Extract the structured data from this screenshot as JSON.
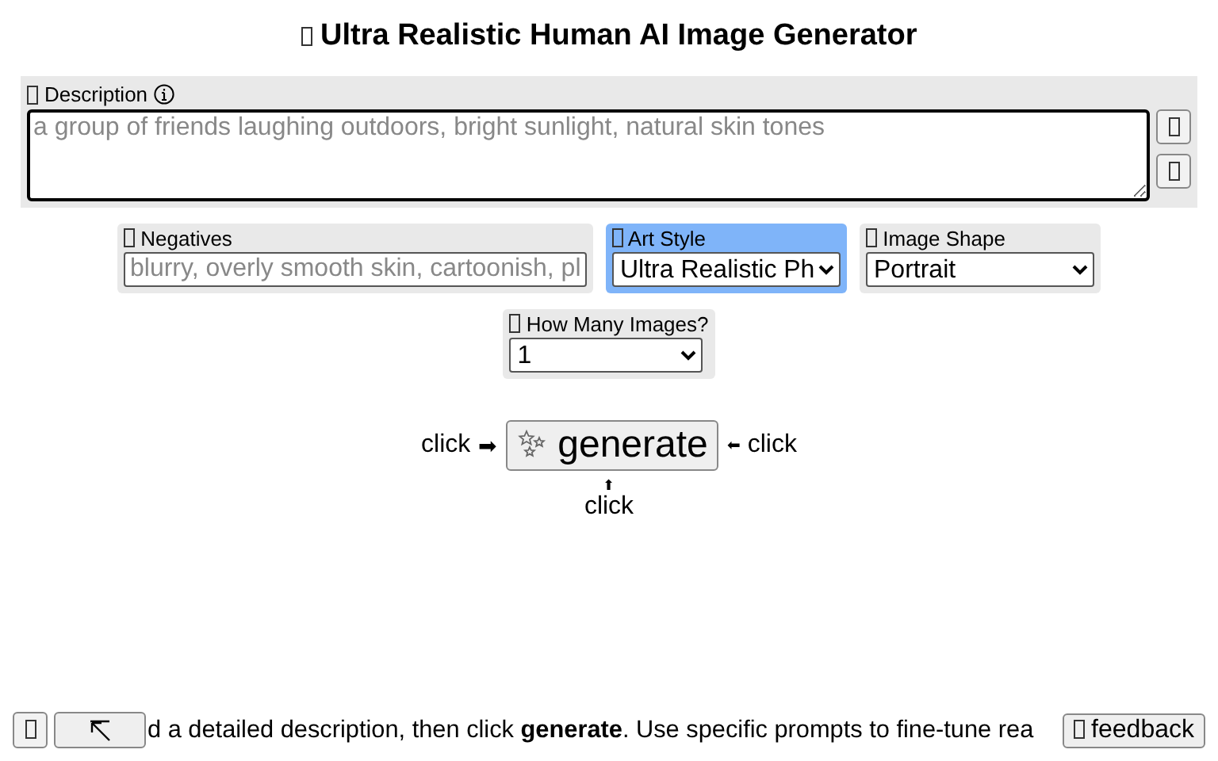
{
  "title": "Ultra Realistic Human AI Image Generator",
  "description": {
    "label": "Description",
    "placeholder": "a group of friends laughing outdoors, bright sunlight, natural skin tones"
  },
  "fields": [
    {
      "kind": "input",
      "label": "Negatives",
      "placeholder": "blurry, overly smooth skin, cartoonish, pl",
      "selected": false
    },
    {
      "kind": "select",
      "label": "Art Style",
      "value": "Ultra Realistic Ph",
      "selected": true
    },
    {
      "kind": "select",
      "label": "Image Shape",
      "value": "Portrait",
      "selected": false
    }
  ],
  "count": {
    "label": "How Many Images?",
    "value": "1"
  },
  "generate": {
    "label": "generate",
    "left_hint": "click",
    "left_arrow": "➡",
    "right_arrow": "⬅",
    "right_hint": "click",
    "bottom_arrow": "⬆",
    "bottom_hint": "click"
  },
  "footer": {
    "text": "d a detailed description, then click **generate**. Use specific prompts to fine-tune rea",
    "feedback": "feedback"
  }
}
